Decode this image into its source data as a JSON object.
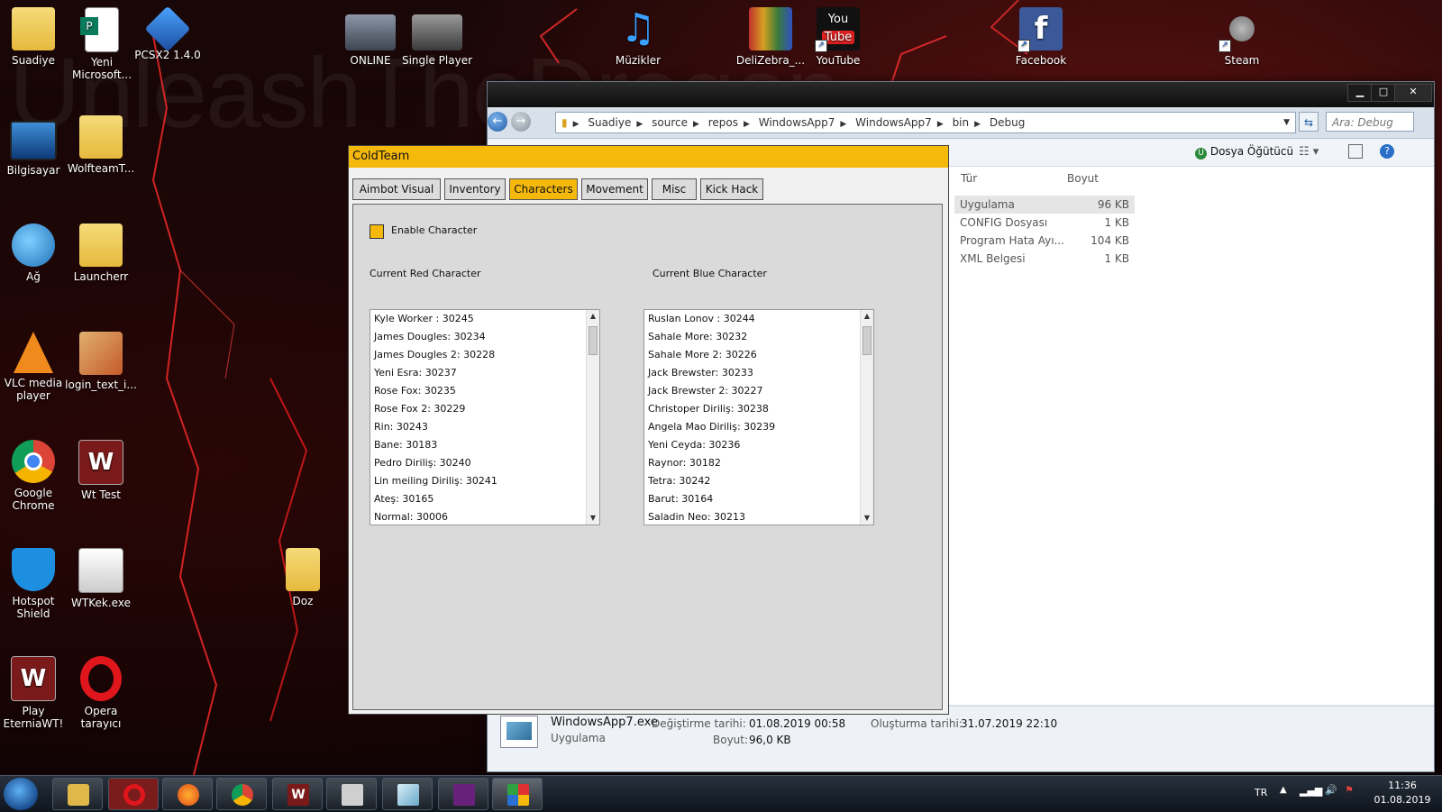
{
  "desktop": {
    "bg_text": "UnleashTheDragon",
    "icons": [
      {
        "label": "Suadiye"
      },
      {
        "label": "Yeni Microsoft..."
      },
      {
        "label": "PCSX2 1.4.0"
      },
      {
        "label": "ONLINE"
      },
      {
        "label": "Single Player"
      },
      {
        "label": "Müzikler"
      },
      {
        "label": "DeliZebra_..."
      },
      {
        "label": "YouTube"
      },
      {
        "label": "Facebook"
      },
      {
        "label": "Steam"
      },
      {
        "label": "Bilgisayar"
      },
      {
        "label": "WolfteamT..."
      },
      {
        "label": "Ağ"
      },
      {
        "label": "Launcherr"
      },
      {
        "label": "VLC media player"
      },
      {
        "label": "login_text_i..."
      },
      {
        "label": "Google Chrome"
      },
      {
        "label": "Wt Test"
      },
      {
        "label": "Hotspot Shield"
      },
      {
        "label": "WTKek.exe"
      },
      {
        "label": "Doz"
      },
      {
        "label": "Play EterniaWT!"
      },
      {
        "label": "Opera tarayıcı"
      }
    ]
  },
  "explorer": {
    "breadcrumb": [
      "Suadiye",
      "source",
      "repos",
      "WindowsApp7",
      "WindowsApp7",
      "bin",
      "Debug"
    ],
    "search_placeholder": "Ara: Debug",
    "advisor_label": "Dosya Öğütücü",
    "columns": {
      "type": "Tür",
      "size": "Boyut"
    },
    "files": [
      {
        "type": "Uygulama",
        "size": "96 KB"
      },
      {
        "type": "CONFIG Dosyası",
        "size": "1 KB"
      },
      {
        "type": "Program Hata Ayı...",
        "size": "104 KB"
      },
      {
        "type": "XML Belgesi",
        "size": "1 KB"
      }
    ],
    "details": {
      "filename": "WindowsApp7.exe",
      "filetype": "Uygulama",
      "modified_label": "Değiştirme tarihi:",
      "modified_value": "01.08.2019 00:58",
      "created_label": "Oluşturma tarihi:",
      "created_value": "31.07.2019 22:10",
      "size_label": "Boyut:",
      "size_value": "96,0 KB"
    }
  },
  "coldteam": {
    "title": "ColdTeam",
    "tabs": [
      "Aimbot Visual",
      "Inventory",
      "Characters",
      "Movement",
      "Misc",
      "Kick Hack"
    ],
    "active_tab": "Characters",
    "enable_label": "Enable Character",
    "red_label": "Current Red Character",
    "blue_label": "Current Blue Character",
    "red_list": [
      "Kyle Worker : 30245",
      "James Dougles: 30234",
      "James Dougles 2: 30228",
      "Yeni Esra: 30237",
      "Rose Fox: 30235",
      "Rose Fox 2: 30229",
      "Rin: 30243",
      "Bane: 30183",
      "Pedro Diriliş: 30240",
      "Lin meiling Diriliş: 30241",
      "Ateş: 30165",
      "Normal: 30006"
    ],
    "blue_list": [
      "Ruslan Lonov : 30244",
      "Sahale More: 30232",
      "Sahale More 2: 30226",
      "Jack Brewster: 30233",
      "Jack Brewster 2: 30227",
      "Christoper Diriliş: 30238",
      "Angela Mao Diriliş: 30239",
      "Yeni Ceyda: 30236",
      "Raynor: 30182",
      "Tetra: 30242",
      "Barut: 30164",
      "Saladin Neo: 30213"
    ]
  },
  "tray": {
    "lang": "TR",
    "time": "11:36",
    "date": "01.08.2019"
  }
}
